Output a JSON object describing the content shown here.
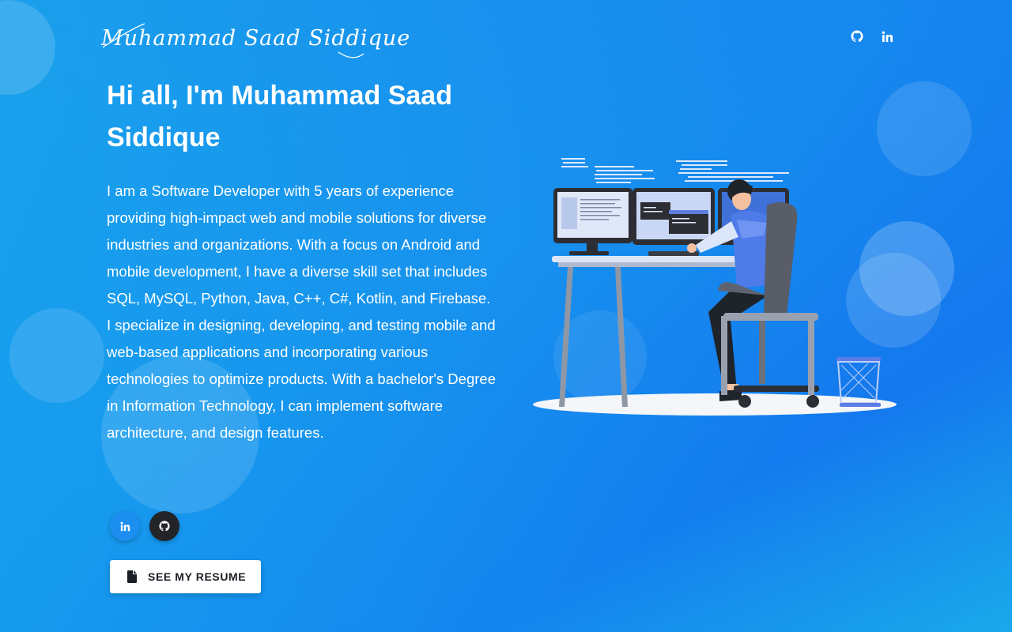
{
  "header": {
    "logo_text": "Muhammad Saad Siddique",
    "icons": [
      {
        "name": "github-icon"
      },
      {
        "name": "linkedin-icon"
      }
    ]
  },
  "hero": {
    "headline": "Hi all, I'm Muhammad Saad Siddique",
    "bio": "I am a Software Developer with 5 years of experience providing high-impact web and mobile solutions for diverse industries and organizations. With a focus on Android and mobile development, I have a diverse skill set that includes SQL, MySQL, Python, Java, C++, C#, Kotlin, and Firebase. I specialize in designing, developing, and testing mobile and web-based applications and incorporating various technologies to optimize products. With a bachelor's Degree in Information Technology, I can implement software architecture, and design features.",
    "social": [
      {
        "name": "linkedin-icon",
        "color": "#1c8ef0"
      },
      {
        "name": "github-icon",
        "color": "#222428"
      }
    ],
    "resume_button": {
      "label": "SEE MY RESUME",
      "icon": "file-icon"
    }
  },
  "illustration": {
    "description_icon": "developer-at-desk-illustration"
  },
  "colors": {
    "background_start": "#1aa3ec",
    "background_end": "#1478ee",
    "button_bg": "#ffffff",
    "linkedin": "#1c8ef0",
    "github": "#222428"
  }
}
